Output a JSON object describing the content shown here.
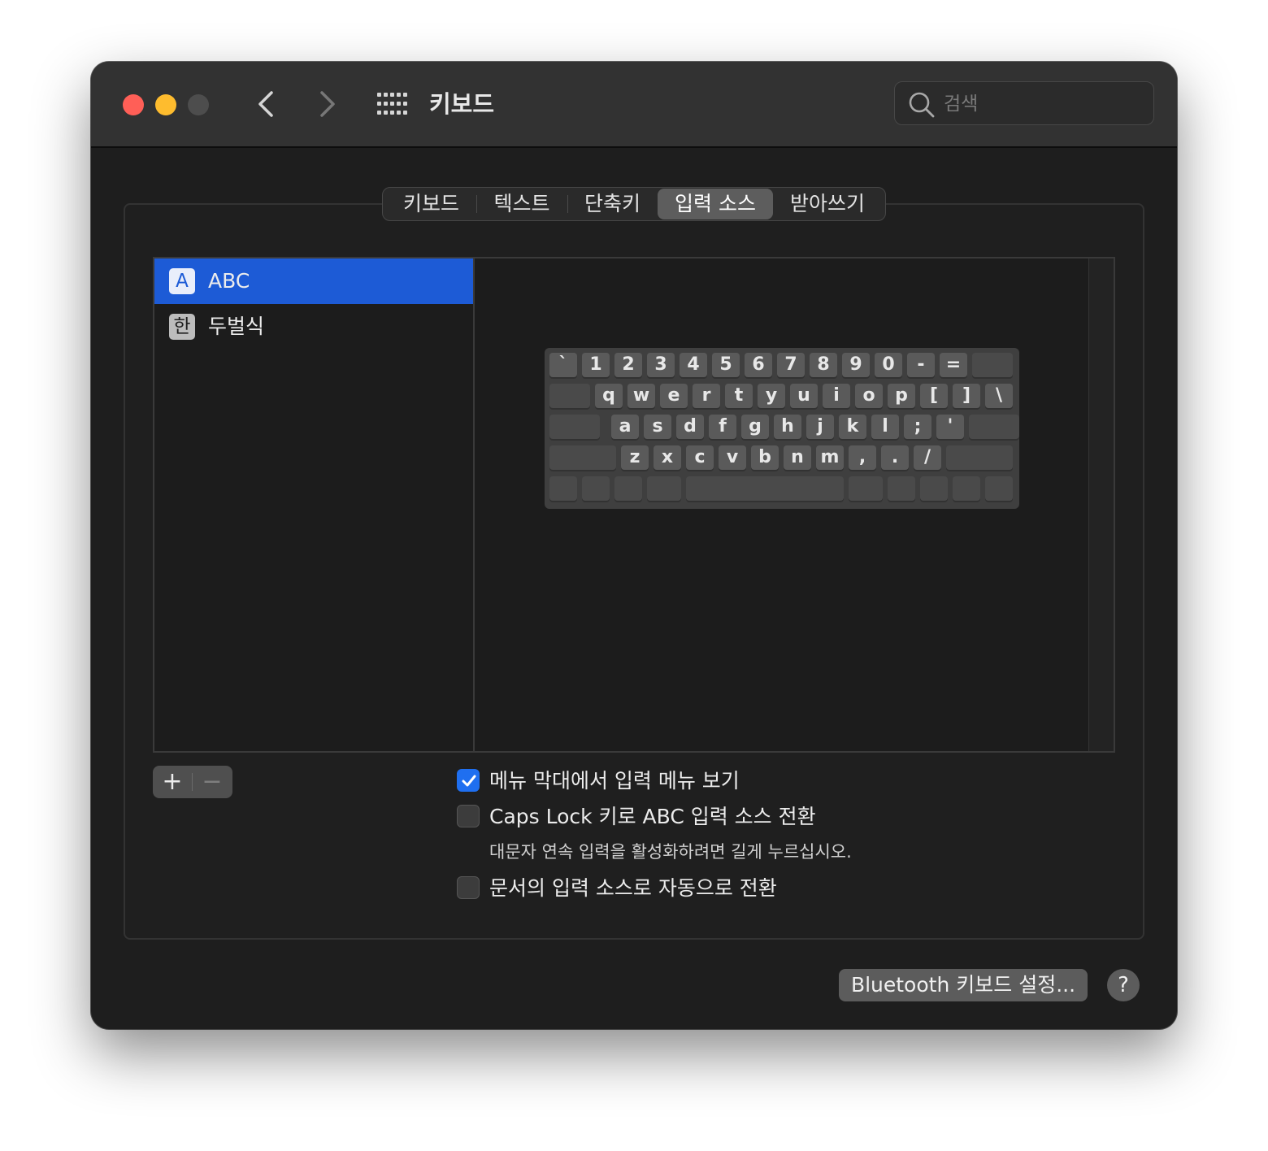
{
  "window": {
    "title": "키보드",
    "search_placeholder": "검색"
  },
  "tabs": [
    {
      "label": "키보드",
      "active": false
    },
    {
      "label": "텍스트",
      "active": false
    },
    {
      "label": "단축키",
      "active": false
    },
    {
      "label": "입력 소스",
      "active": true
    },
    {
      "label": "받아쓰기",
      "active": false
    }
  ],
  "sources": [
    {
      "icon": "A",
      "label": "ABC",
      "selected": true
    },
    {
      "icon": "한",
      "label": "두벌식",
      "selected": false
    }
  ],
  "keyboard": {
    "row1": [
      "`",
      "1",
      "2",
      "3",
      "4",
      "5",
      "6",
      "7",
      "8",
      "9",
      "0",
      "-",
      "="
    ],
    "row2": [
      "q",
      "w",
      "e",
      "r",
      "t",
      "y",
      "u",
      "i",
      "o",
      "p",
      "[",
      "]",
      "\\"
    ],
    "row3": [
      "a",
      "s",
      "d",
      "f",
      "g",
      "h",
      "j",
      "k",
      "l",
      ";",
      "'"
    ],
    "row4": [
      "z",
      "x",
      "c",
      "v",
      "b",
      "n",
      "m",
      ",",
      ".",
      "/"
    ]
  },
  "list_controls": {
    "add": "+",
    "remove": "−"
  },
  "options": [
    {
      "label": "메뉴 막대에서 입력 메뉴 보기",
      "checked": true
    },
    {
      "label": "Caps Lock 키로 ABC 입력 소스 전환",
      "checked": false
    },
    {
      "label": "문서의 입력 소스로 자동으로 전환",
      "checked": false
    }
  ],
  "caps_hint": "대문자 연속 입력을 활성화하려면 길게 누르십시오.",
  "bluetooth_button": "Bluetooth 키보드 설정...",
  "help_button": "?",
  "colors": {
    "accent": "#1d5bd6",
    "checkbox": "#1f6ff0"
  }
}
